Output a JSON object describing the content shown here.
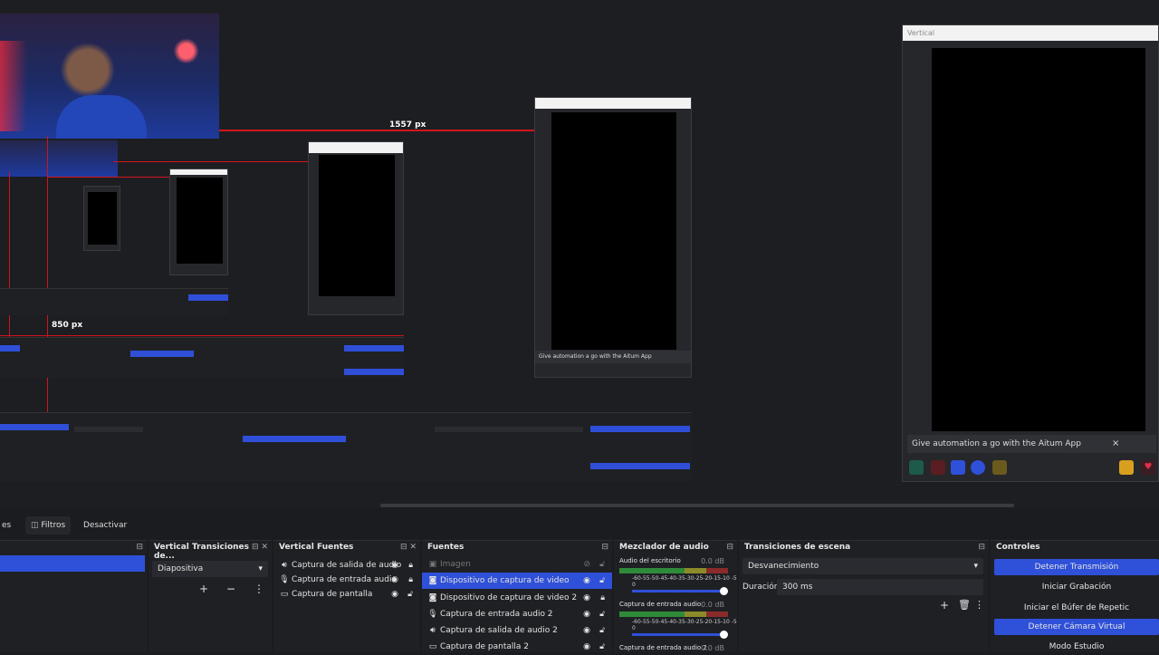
{
  "preview": {
    "measure_width": "1557 px",
    "measure_height": "850 px",
    "vertical_window_title": "Vertical",
    "notice": "Give automation a go with the Aitum App",
    "notice_close": "×"
  },
  "toolbar": {
    "properties_label": "es",
    "filters_label": "Filtros",
    "deactivate_label": "Desactivar"
  },
  "docks": {
    "vtransitions": {
      "title": "Vertical Transiciones de...",
      "value": "Diapositiva",
      "add": "+",
      "remove": "−",
      "more": "⋮"
    },
    "vsources": {
      "title": "Vertical Fuentes",
      "items": [
        {
          "label": "Captura de salida de audio",
          "icon": "speaker-icon"
        },
        {
          "label": "Captura de entrada audio",
          "icon": "mic-icon"
        },
        {
          "label": "Captura de pantalla",
          "icon": "monitor-icon"
        }
      ]
    },
    "sources": {
      "title": "Fuentes",
      "items": [
        {
          "label": "Imagen",
          "icon": "image-icon"
        },
        {
          "label": "Dispositivo de captura de video",
          "icon": "camera-icon"
        },
        {
          "label": "Dispositivo de captura de video 2",
          "icon": "camera-icon"
        },
        {
          "label": "Captura de entrada audio 2",
          "icon": "mic-icon"
        },
        {
          "label": "Captura de salida de audio 2",
          "icon": "speaker-icon"
        },
        {
          "label": "Captura de pantalla 2",
          "icon": "monitor-icon"
        }
      ]
    },
    "mixer": {
      "title": "Mezclador de audio",
      "channels": [
        {
          "name": "Audio del escritorio",
          "db": "0.0 dB"
        },
        {
          "name": "Captura de entrada audio",
          "db": "0.0 dB"
        },
        {
          "name": "Captura de entrada audio 2",
          "db": "0.0 dB"
        }
      ],
      "scale": "-60-55-50-45-40-35-30-25-20-15-10 -5 0"
    },
    "transitions": {
      "title": "Transiciones de escena",
      "value": "Desvanecimiento",
      "duration_label": "Duración",
      "duration_value": "300 ms"
    },
    "controls": {
      "title": "Controles",
      "buttons": [
        {
          "label": "Detener Transmisión",
          "active": true
        },
        {
          "label": "Iniciar Grabación",
          "active": false
        },
        {
          "label": "Iniciar el Búfer de Repetic",
          "active": false
        },
        {
          "label": "Detener Cámara Virtual",
          "active": true
        },
        {
          "label": "Modo Estudio",
          "active": false
        }
      ]
    }
  },
  "colors": {
    "accent": "#2f50d8",
    "guide_red": "#d0141c"
  }
}
